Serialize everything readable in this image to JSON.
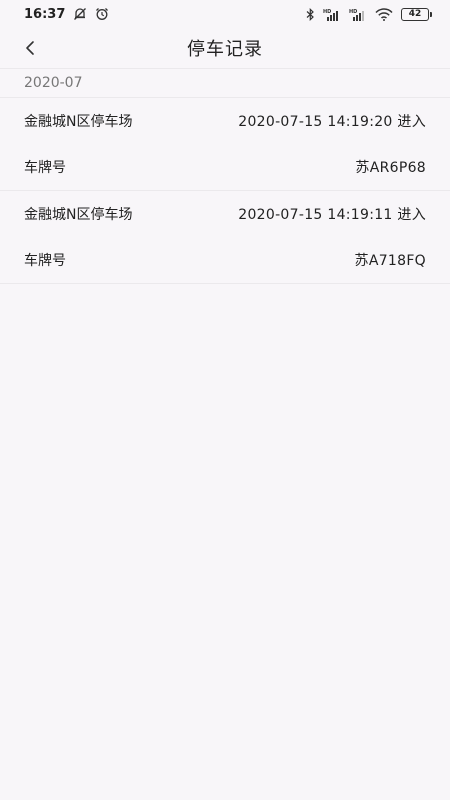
{
  "status_bar": {
    "time": "16:37",
    "battery": "42"
  },
  "header": {
    "title": "停车记录"
  },
  "month": "2020-07",
  "records": [
    {
      "lot_name": "金融城N区停车场",
      "time_status": "2020-07-15 14:19:20 进入",
      "plate_label": "车牌号",
      "plate": "苏AR6P68"
    },
    {
      "lot_name": "金融城N区停车场",
      "time_status": "2020-07-15 14:19:11 进入",
      "plate_label": "车牌号",
      "plate": "苏A718FQ"
    }
  ]
}
